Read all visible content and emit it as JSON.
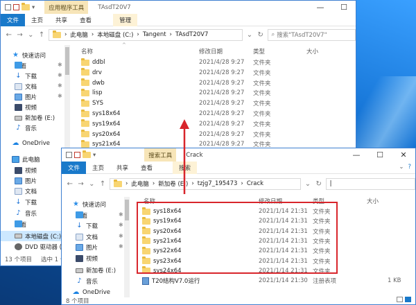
{
  "back": {
    "quick_access": "",
    "tab_file": "文件",
    "tab_home": "主页",
    "tab_share": "共享",
    "tab_view": "查看",
    "ctx_tab": "应用程序工具",
    "ctx_manage": "管理",
    "title": "TAsdT20V7",
    "path": [
      "此电脑",
      "本地磁盘 (C:)",
      "Tangent",
      "TAsdT20V7"
    ],
    "search_placeholder": "搜索\"TAsdT20V7\"",
    "columns": {
      "name": "名称",
      "date": "修改日期",
      "type": "类型",
      "size": "大小"
    },
    "sidebar": [
      {
        "label": "快速访问",
        "icon": "star-icon"
      },
      {
        "label": "桌面",
        "icon": "desktop-icon",
        "pinned": true
      },
      {
        "label": "下载",
        "icon": "download-icon",
        "pinned": true
      },
      {
        "label": "文档",
        "icon": "documents-icon",
        "pinned": true
      },
      {
        "label": "图片",
        "icon": "pictures-icon",
        "pinned": true
      },
      {
        "label": "视频",
        "icon": "videos-icon"
      },
      {
        "label": "新加卷 (E:)",
        "icon": "drive-icon"
      },
      {
        "label": "音乐",
        "icon": "music-icon"
      },
      {
        "label": "OneDrive",
        "icon": "onedrive-icon"
      },
      {
        "label": "此电脑",
        "icon": "this-pc-icon"
      },
      {
        "label": "视频",
        "icon": "videos-icon"
      },
      {
        "label": "图片",
        "icon": "pictures-icon"
      },
      {
        "label": "文档",
        "icon": "documents-icon"
      },
      {
        "label": "下载",
        "icon": "download-icon"
      },
      {
        "label": "音乐",
        "icon": "music-icon"
      },
      {
        "label": "桌面",
        "icon": "desktop-icon"
      },
      {
        "label": "本地磁盘 (C:)",
        "icon": "drive-icon",
        "selected": true
      },
      {
        "label": "DVD 驱动器 (D",
        "icon": "dvd-icon"
      }
    ],
    "files": [
      {
        "name": "ddbl",
        "date": "2021/4/28 9:27",
        "type": "文件夹"
      },
      {
        "name": "drv",
        "date": "2021/4/28 9:27",
        "type": "文件夹"
      },
      {
        "name": "dwb",
        "date": "2021/4/28 9:27",
        "type": "文件夹"
      },
      {
        "name": "lisp",
        "date": "2021/4/28 9:27",
        "type": "文件夹"
      },
      {
        "name": "SYS",
        "date": "2021/4/28 9:27",
        "type": "文件夹"
      },
      {
        "name": "sys18x64",
        "date": "2021/4/28 9:27",
        "type": "文件夹"
      },
      {
        "name": "sys19x64",
        "date": "2021/4/28 9:27",
        "type": "文件夹"
      },
      {
        "name": "sys20x64",
        "date": "2021/4/28 9:27",
        "type": "文件夹"
      },
      {
        "name": "sys21x64",
        "date": "2021/4/28 9:27",
        "type": "文件夹"
      },
      {
        "name": "sys22x64",
        "date": "2021/4/28 9:27",
        "type": "文件夹"
      }
    ],
    "status": "13 个项目",
    "status2": "选中 1 个项"
  },
  "front": {
    "tab_file": "文件",
    "tab_home": "主页",
    "tab_share": "共享",
    "tab_view": "查看",
    "ctx_tab": "搜索工具",
    "ctx_search": "搜索",
    "title": "Crack",
    "path": [
      "此电脑",
      "新加卷 (E:)",
      "tzjg7_195473",
      "Crack"
    ],
    "columns": {
      "name": "名称",
      "date": "修改日期",
      "type": "类型",
      "size": "大小"
    },
    "sidebar": [
      {
        "label": "快速访问",
        "icon": "star-icon"
      },
      {
        "label": "桌面",
        "icon": "desktop-icon",
        "pinned": true
      },
      {
        "label": "下载",
        "icon": "download-icon",
        "pinned": true
      },
      {
        "label": "文档",
        "icon": "documents-icon",
        "pinned": true
      },
      {
        "label": "图片",
        "icon": "pictures-icon",
        "pinned": true
      },
      {
        "label": "视频",
        "icon": "videos-icon"
      },
      {
        "label": "新加卷 (E:)",
        "icon": "drive-icon"
      },
      {
        "label": "音乐",
        "icon": "music-icon"
      },
      {
        "label": "OneDrive",
        "icon": "onedrive-icon"
      }
    ],
    "files": [
      {
        "name": "sys18x64",
        "date": "2021/1/14 21:31",
        "type": "文件夹",
        "size": ""
      },
      {
        "name": "sys19x64",
        "date": "2021/1/14 21:31",
        "type": "文件夹",
        "size": ""
      },
      {
        "name": "sys20x64",
        "date": "2021/1/14 21:31",
        "type": "文件夹",
        "size": ""
      },
      {
        "name": "sys21x64",
        "date": "2021/1/14 21:31",
        "type": "文件夹",
        "size": ""
      },
      {
        "name": "sys22x64",
        "date": "2021/1/14 21:31",
        "type": "文件夹",
        "size": ""
      },
      {
        "name": "sys23x64",
        "date": "2021/1/14 21:31",
        "type": "文件夹",
        "size": ""
      },
      {
        "name": "sys24x64",
        "date": "2021/1/14 21:31",
        "type": "文件夹",
        "size": ""
      },
      {
        "name": "T20结构V7.0运行",
        "date": "2021/1/14 21:30",
        "type": "注册表项",
        "size": "1 KB"
      }
    ],
    "status": "8 个项目"
  },
  "colors": {
    "highlight_box": "#d8252b",
    "arrow": "#d8252b",
    "file_tab": "#1979ca"
  }
}
